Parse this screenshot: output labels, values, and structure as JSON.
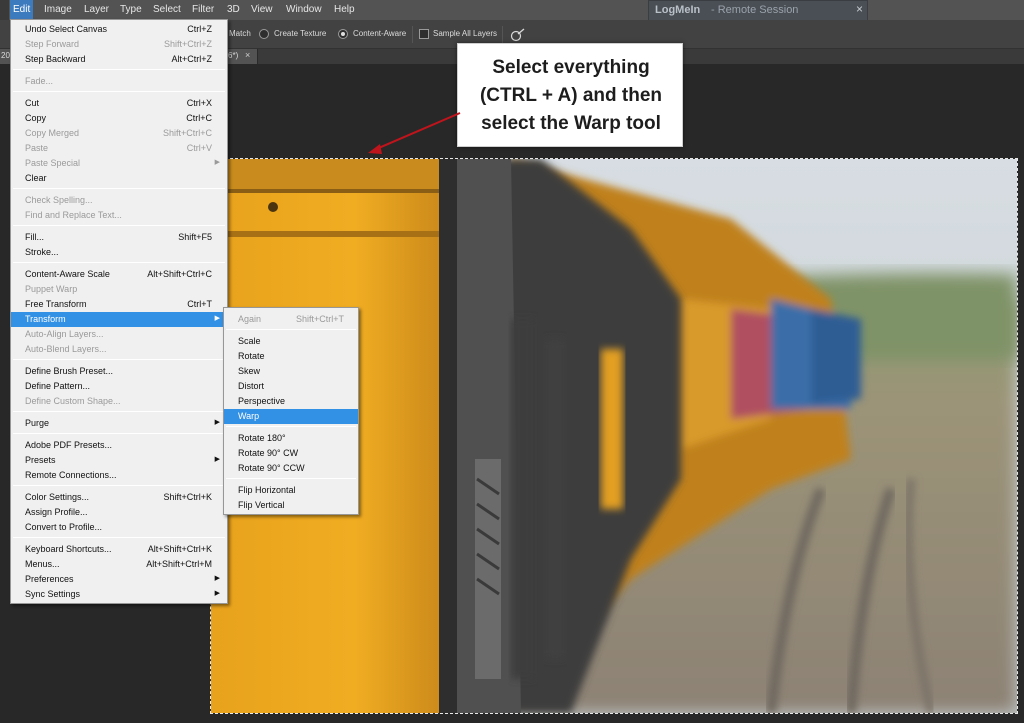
{
  "menubar": {
    "items": [
      "Edit",
      "Image",
      "Layer",
      "Type",
      "Select",
      "Filter",
      "3D",
      "View",
      "Window",
      "Help"
    ],
    "active_item": "Edit"
  },
  "remote_session": {
    "title": "LogMeIn",
    "subtitle": "- Remote Session",
    "close_glyph": "×"
  },
  "options": {
    "match_label": "Match",
    "texture_label": "Create Texture",
    "content_aware_label": "Content-Aware",
    "content_aware_selected": true,
    "sample_all_label": "Sample All Layers",
    "sample_all_checked": false
  },
  "document_tab": {
    "left_text": "20",
    "right_text": "6*)",
    "close_glyph": "×"
  },
  "edit_menu": {
    "items": [
      {
        "label": "Undo Select Canvas",
        "shortcut": "Ctrl+Z",
        "disabled": false
      },
      {
        "label": "Step Forward",
        "shortcut": "Shift+Ctrl+Z",
        "disabled": true
      },
      {
        "label": "Step Backward",
        "shortcut": "Alt+Ctrl+Z",
        "disabled": false
      },
      {
        "label": "Fade...",
        "shortcut": "",
        "disabled": true
      },
      {
        "label": "Cut",
        "shortcut": "Ctrl+X",
        "disabled": false
      },
      {
        "label": "Copy",
        "shortcut": "Ctrl+C",
        "disabled": false
      },
      {
        "label": "Copy Merged",
        "shortcut": "Shift+Ctrl+C",
        "disabled": true
      },
      {
        "label": "Paste",
        "shortcut": "Ctrl+V",
        "disabled": true
      },
      {
        "label": "Paste Special",
        "shortcut": "",
        "disabled": true,
        "submenu": true
      },
      {
        "label": "Clear",
        "shortcut": "",
        "disabled": false
      },
      {
        "label": "Check Spelling...",
        "shortcut": "",
        "disabled": true
      },
      {
        "label": "Find and Replace Text...",
        "shortcut": "",
        "disabled": true
      },
      {
        "label": "Fill...",
        "shortcut": "Shift+F5",
        "disabled": false
      },
      {
        "label": "Stroke...",
        "shortcut": "",
        "disabled": false
      },
      {
        "label": "Content-Aware Scale",
        "shortcut": "Alt+Shift+Ctrl+C",
        "disabled": false
      },
      {
        "label": "Puppet Warp",
        "shortcut": "",
        "disabled": true
      },
      {
        "label": "Free Transform",
        "shortcut": "Ctrl+T",
        "disabled": false
      },
      {
        "label": "Transform",
        "shortcut": "",
        "disabled": false,
        "submenu": true,
        "highlight": true
      },
      {
        "label": "Auto-Align Layers...",
        "shortcut": "",
        "disabled": true
      },
      {
        "label": "Auto-Blend Layers...",
        "shortcut": "",
        "disabled": true
      },
      {
        "label": "Define Brush Preset...",
        "shortcut": "",
        "disabled": false
      },
      {
        "label": "Define Pattern...",
        "shortcut": "",
        "disabled": false
      },
      {
        "label": "Define Custom Shape...",
        "shortcut": "",
        "disabled": true
      },
      {
        "label": "Purge",
        "shortcut": "",
        "disabled": false,
        "submenu": true
      },
      {
        "label": "Adobe PDF Presets...",
        "shortcut": "",
        "disabled": false
      },
      {
        "label": "Presets",
        "shortcut": "",
        "disabled": false,
        "submenu": true
      },
      {
        "label": "Remote Connections...",
        "shortcut": "",
        "disabled": false
      },
      {
        "label": "Color Settings...",
        "shortcut": "Shift+Ctrl+K",
        "disabled": false
      },
      {
        "label": "Assign Profile...",
        "shortcut": "",
        "disabled": false
      },
      {
        "label": "Convert to Profile...",
        "shortcut": "",
        "disabled": false
      },
      {
        "label": "Keyboard Shortcuts...",
        "shortcut": "Alt+Shift+Ctrl+K",
        "disabled": false
      },
      {
        "label": "Menus...",
        "shortcut": "Alt+Shift+Ctrl+M",
        "disabled": false
      },
      {
        "label": "Preferences",
        "shortcut": "",
        "disabled": false,
        "submenu": true
      },
      {
        "label": "Sync Settings",
        "shortcut": "",
        "disabled": false,
        "submenu": true
      }
    ],
    "submenu_glyph": "▶"
  },
  "transform_submenu": {
    "items": [
      {
        "label": "Again",
        "shortcut": "Shift+Ctrl+T",
        "disabled": true
      },
      {
        "label": "Scale",
        "shortcut": "",
        "disabled": false
      },
      {
        "label": "Rotate",
        "shortcut": "",
        "disabled": false
      },
      {
        "label": "Skew",
        "shortcut": "",
        "disabled": false
      },
      {
        "label": "Distort",
        "shortcut": "",
        "disabled": false
      },
      {
        "label": "Perspective",
        "shortcut": "",
        "disabled": false
      },
      {
        "label": "Warp",
        "shortcut": "",
        "disabled": false,
        "highlight": true
      },
      {
        "label": "Rotate 180°",
        "shortcut": "",
        "disabled": false
      },
      {
        "label": "Rotate 90° CW",
        "shortcut": "",
        "disabled": false
      },
      {
        "label": "Rotate 90° CCW",
        "shortcut": "",
        "disabled": false
      },
      {
        "label": "Flip Horizontal",
        "shortcut": "",
        "disabled": false
      },
      {
        "label": "Flip Vertical",
        "shortcut": "",
        "disabled": false
      }
    ]
  },
  "callout": {
    "lines": [
      "Select everything",
      "(CTRL + A) and then",
      "select the Warp tool"
    ]
  }
}
